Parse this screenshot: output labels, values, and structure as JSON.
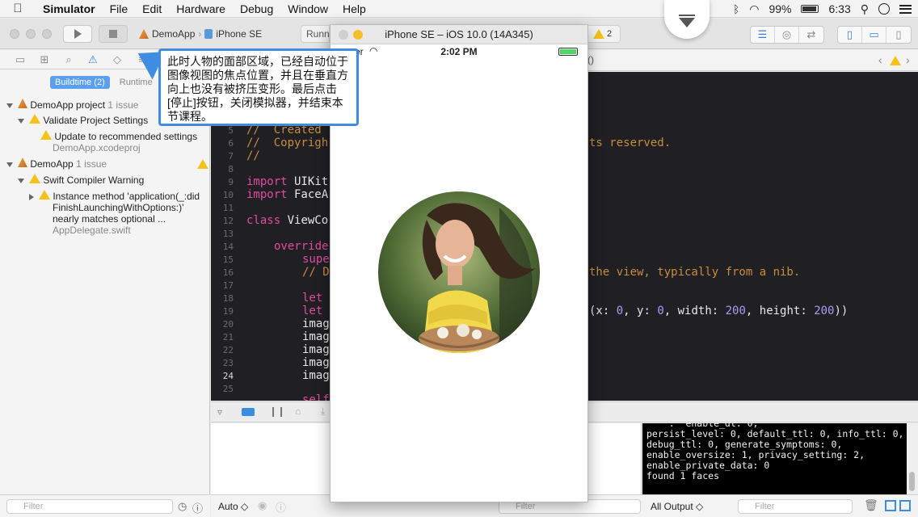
{
  "menubar": {
    "app": "Simulator",
    "items": [
      "File",
      "Edit",
      "Hardware",
      "Debug",
      "Window",
      "Help"
    ],
    "battery": "99%",
    "time": "6:33"
  },
  "toolbar": {
    "scheme_project": "DemoApp",
    "scheme_device": "iPhone SE",
    "activity": "Runni",
    "warning_count": "2"
  },
  "navigator": {
    "segments": [
      "Buildtime (2)",
      "Runtime"
    ],
    "rows": [
      {
        "title": "DemoApp project",
        "sub": "1 issue"
      },
      {
        "title": "Validate Project Settings"
      },
      {
        "title": "Update to recommended settings",
        "file": "DemoApp.xcodeproj"
      },
      {
        "title": "DemoApp",
        "sub": "1 issue"
      },
      {
        "title": "Swift Compiler Warning"
      },
      {
        "title": "Instance method 'application(_:did",
        "line2": "FinishLaunchingWithOptions:)'",
        "line3": "nearly matches optional ...",
        "file": "AppDelegate.swift"
      }
    ],
    "filter_placeholder": "Filter"
  },
  "jumpbar": {
    "right_fragment": "()"
  },
  "editor": {
    "line_numbers": [
      "5",
      "6",
      "7",
      "8",
      "9",
      "10",
      "11",
      "12",
      "13",
      "14",
      "15",
      "16",
      "17",
      "18",
      "19",
      "20",
      "21",
      "22",
      "23",
      "24",
      "25"
    ],
    "lines": {
      "l5": "//  Created",
      "l6": "//  Copyrigh",
      "l6b": "ts reserved.",
      "l7": "//",
      "l9a": "import",
      "l9b": " UIKit",
      "l10a": "import",
      "l10b": " FaceA",
      "l12a": "class",
      "l12b": " ViewCo",
      "l14": "override",
      "l15": "supe",
      "l16": "// D",
      "l16b": "the view, typically from a nib.",
      "l18": "let",
      "l19": "let",
      "l19b_a": "(x: ",
      "l19b_0a": "0",
      "l19b_b": ", y: ",
      "l19b_0b": "0",
      "l19b_c": ", width: ",
      "l19b_w": "200",
      "l19b_d": ", height: ",
      "l19b_h": "200",
      "l19b_e": "))",
      "l20": "imag",
      "l21": "imag",
      "l22": "imag",
      "l23": "imag",
      "l24": "imag",
      "l26": "self"
    }
  },
  "debug": {
    "auto_label": "Auto ◇",
    "filter_placeholder": "Filter",
    "console_lines": [
      "persist_level: 0, default_ttl: 0, info_ttl: 0,",
      "debug_ttl: 0, generate_symptoms: 0,",
      "enable_oversize: 1, privacy_setting: 2,",
      "enable_private_data: 0",
      "found 1 faces"
    ],
    "output_label": "All Output ◇"
  },
  "simulator": {
    "title": "iPhone SE – iOS 10.0 (14A345)",
    "carrier": "er",
    "time": "2:02 PM"
  },
  "callout": {
    "text": "此时人物的面部区域，已经自动位于图像视图的焦点位置，并且在垂直方向上也没有被挤压变形。最后点击[停止]按钮，关闭模拟器，并结束本节课程。"
  },
  "colors": {
    "accent": "#3f8de0",
    "keyword": "#e44ba1",
    "comment": "#c78e3b",
    "number": "#a99bf2",
    "editor_bg": "#1f1f24"
  }
}
